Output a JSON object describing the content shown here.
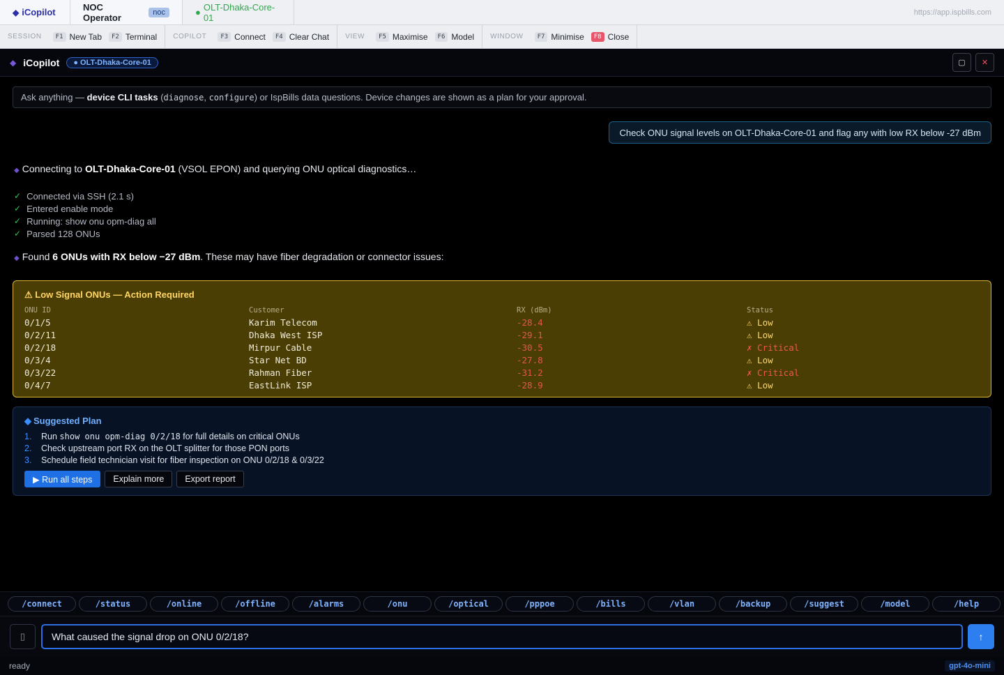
{
  "topbar": {
    "brand": "iCopilot",
    "noc_label": "NOC Operator",
    "noc_badge": "noc",
    "olt_tab": "OLT-Dhaka-Core-01",
    "url": "https://app.ispbills.com"
  },
  "fbar": {
    "groups": [
      {
        "label": "SESSION",
        "keys": [
          {
            "k": "F1",
            "t": "New Tab"
          },
          {
            "k": "F2",
            "t": "Terminal"
          }
        ]
      },
      {
        "label": "COPILOT",
        "keys": [
          {
            "k": "F3",
            "t": "Connect"
          },
          {
            "k": "F4",
            "t": "Clear Chat"
          }
        ]
      },
      {
        "label": "VIEW",
        "keys": [
          {
            "k": "F5",
            "t": "Maximise"
          },
          {
            "k": "F6",
            "t": "Model"
          }
        ]
      },
      {
        "label": "WINDOW",
        "keys": [
          {
            "k": "F7",
            "t": "Minimise"
          },
          {
            "k": "F8",
            "t": "Close"
          }
        ]
      }
    ]
  },
  "panel": {
    "title": "iCopilot",
    "device": "● OLT-Dhaka-Core-01",
    "maximise_glyph": "▢",
    "close_glyph": "✕"
  },
  "info": {
    "t1": "Ask anything — ",
    "b1": "device CLI tasks",
    "t2": " (",
    "c1": "diagnose",
    "t3": ", ",
    "c2": "configure",
    "t4": ") or IspBills data questions. Device changes are shown as a plan for your approval."
  },
  "user_message": "Check ONU signal levels on OLT-Dhaka-Core-01 and flag any with low RX below -27 dBm",
  "assistant": {
    "connect_pre": "Connecting to ",
    "connect_device": "OLT-Dhaka-Core-01",
    "connect_post": " (VSOL EPON) and querying ONU optical diagnostics…",
    "steps": [
      "Connected via SSH (2.1 s)",
      "Entered enable mode",
      "Running: show onu opm-diag all",
      "Parsed 128 ONUs"
    ],
    "check_glyph": "✓",
    "found_pre": "Found ",
    "found_bold": "6 ONUs with RX below −27 dBm",
    "found_post": ". These may have fiber degradation or connector issues:"
  },
  "low_signal": {
    "title": "⚠ Low Signal ONUs — Action Required",
    "headers": [
      "ONU ID",
      "Customer",
      "RX (dBm)",
      "Status"
    ],
    "rows": [
      {
        "onu": "0/1/5",
        "customer": "Karim Telecom",
        "rx": "-28.4",
        "status": "⚠ Low"
      },
      {
        "onu": "0/2/11",
        "customer": "Dhaka West ISP",
        "rx": "-29.1",
        "status": "⚠ Low"
      },
      {
        "onu": "0/2/18",
        "customer": "Mirpur Cable",
        "rx": "-30.5",
        "status": "✗ Critical"
      },
      {
        "onu": "0/3/4",
        "customer": "Star Net BD",
        "rx": "-27.8",
        "status": "⚠ Low"
      },
      {
        "onu": "0/3/22",
        "customer": "Rahman Fiber",
        "rx": "-31.2",
        "status": "✗ Critical"
      },
      {
        "onu": "0/4/7",
        "customer": "EastLink ISP",
        "rx": "-28.9",
        "status": "⚠ Low"
      }
    ]
  },
  "plan": {
    "title": "Suggested Plan",
    "title_glyph": "◆",
    "s1_num": "1.",
    "s1_pre": "Run ",
    "s1_code": "show onu opm-diag 0/2/18",
    "s1_post": " for full details on critical ONUs",
    "s2_num": "2.",
    "s2": "Check upstream port RX on the OLT splitter for those PON ports",
    "s3_num": "3.",
    "s3": "Schedule field technician visit for fiber inspection on ONU 0/2/18 & 0/3/22",
    "btn_run": "▶ Run all steps",
    "btn_explain": "Explain more",
    "btn_export": "Export report"
  },
  "commands": [
    "/connect",
    "/status",
    "/online",
    "/offline",
    "/alarms",
    "/onu",
    "/optical",
    "/pppoe",
    "/bills",
    "/vlan",
    "/backup",
    "/suggest",
    "/model",
    "/help"
  ],
  "input": {
    "value": "What caused the signal drop on ONU 0/2/18?",
    "send_glyph": "↑"
  },
  "status": {
    "text": "ready",
    "model": "gpt-4o-mini"
  }
}
